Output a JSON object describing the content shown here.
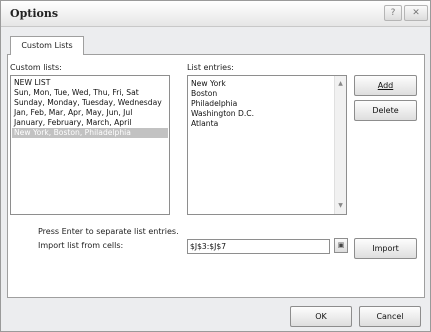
{
  "window": {
    "title": "Options",
    "help_glyph": "?",
    "close_glyph": "✕"
  },
  "tabs": [
    {
      "label": "Custom Lists"
    }
  ],
  "custom_lists": {
    "label": "Custom lists:",
    "items": [
      "NEW LIST",
      "Sun, Mon, Tue, Wed, Thu, Fri, Sat",
      "Sunday, Monday, Tuesday, Wednesday",
      "Jan, Feb, Mar, Apr, May, Jun, Jul",
      "January, February, March, April",
      "New York, Boston, Philadelphia"
    ],
    "selected_index": 5
  },
  "list_entries": {
    "label": "List entries:",
    "items": [
      "New York",
      "Boston",
      "Philadelphia",
      "Washington D.C.",
      "Atlanta"
    ]
  },
  "buttons": {
    "add": "Add",
    "delete": "Delete",
    "import": "Import",
    "ok": "OK",
    "cancel": "Cancel"
  },
  "hint": "Press Enter to separate list entries.",
  "import": {
    "label": "Import list from cells:",
    "range": "$J$3:$J$7"
  },
  "icons": {
    "scroll_up": "▲",
    "scroll_down": "▼",
    "collapse": "▣"
  }
}
